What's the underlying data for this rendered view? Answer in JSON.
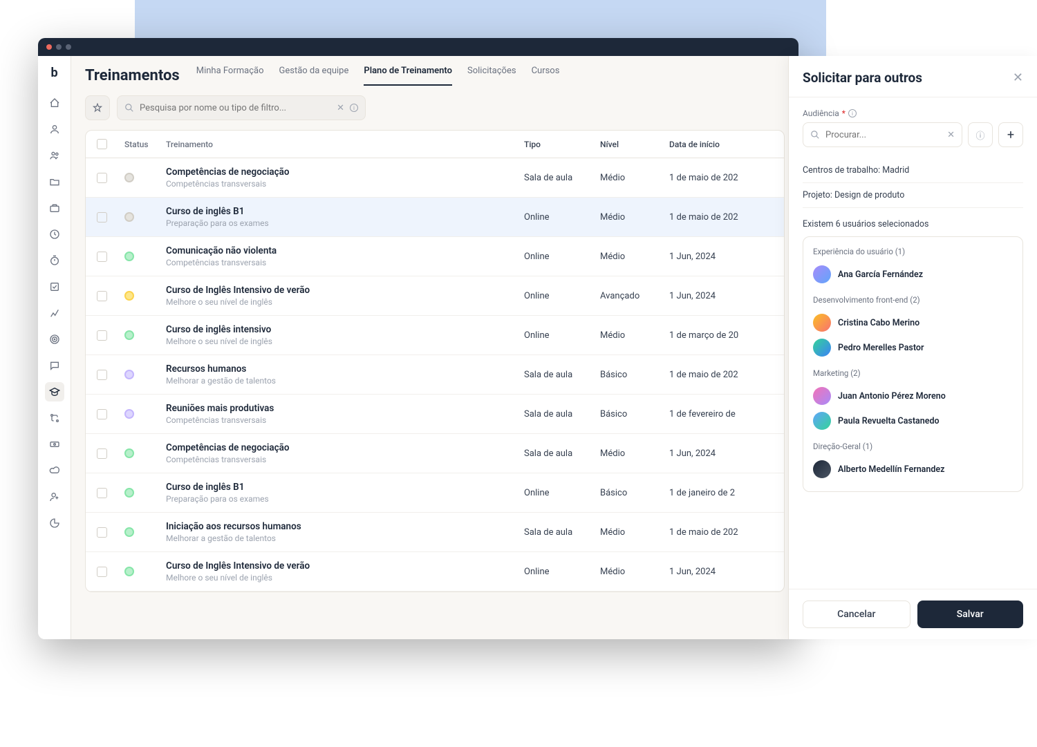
{
  "pageTitle": "Treinamentos",
  "tabs": [
    "Minha Formação",
    "Gestão da equipe",
    "Plano de Treinamento",
    "Solicitações",
    "Cursos"
  ],
  "activeTab": 2,
  "searchPlaceholder": "Pesquisa por nome ou tipo de filtro...",
  "columns": {
    "status": "Status",
    "name": "Treinamento",
    "type": "Tipo",
    "level": "Nível",
    "date": "Data de início"
  },
  "rows": [
    {
      "status": "grey",
      "title": "Competências de negociação",
      "sub": "Competências transversais",
      "type": "Sala de aula",
      "level": "Médio",
      "date": "1 de maio de 202"
    },
    {
      "status": "grey",
      "title": "Curso de inglês B1",
      "sub": "Preparação para os exames",
      "type": "Online",
      "level": "Médio",
      "date": "1 de maio de 202",
      "selected": true
    },
    {
      "status": "green",
      "title": "Comunicação não violenta",
      "sub": "Competências transversais",
      "type": "Online",
      "level": "Médio",
      "date": "1 Jun, 2024"
    },
    {
      "status": "yellow",
      "title": "Curso de Inglês Intensivo de verão",
      "sub": "Melhore o seu nível de inglês",
      "type": "Online",
      "level": "Avançado",
      "date": "1 Jun, 2024"
    },
    {
      "status": "green",
      "title": "Curso de inglês intensivo",
      "sub": "Melhore o seu nível de inglês",
      "type": "Online",
      "level": "Médio",
      "date": "1 de março de 20"
    },
    {
      "status": "purple",
      "title": "Recursos humanos",
      "sub": "Melhorar a gestão de talentos",
      "type": "Sala de aula",
      "level": "Básico",
      "date": "1 de maio de 202"
    },
    {
      "status": "purple",
      "title": "Reuniões mais produtivas",
      "sub": "Competências transversais",
      "type": "Sala de aula",
      "level": "Básico",
      "date": "1 de fevereiro de"
    },
    {
      "status": "green",
      "title": "Competências de negociação",
      "sub": "Competências transversais",
      "type": "Sala de aula",
      "level": "Médio",
      "date": "1 Jun, 2024"
    },
    {
      "status": "green",
      "title": "Curso de inglês B1",
      "sub": "Preparação para os exames",
      "type": "Online",
      "level": "Básico",
      "date": "1 de janeiro de 2"
    },
    {
      "status": "green",
      "title": "Iniciação aos recursos humanos",
      "sub": "Melhorar a gestão de talentos",
      "type": "Sala de aula",
      "level": "Médio",
      "date": "1 de maio de 202"
    },
    {
      "status": "green",
      "title": "Curso de Inglês Intensivo de verão",
      "sub": "Melhore o seu nível de inglês",
      "type": "Online",
      "level": "Médio",
      "date": "1 Jun, 2024"
    }
  ],
  "panel": {
    "title": "Solicitar para outros",
    "audienceLabel": "Audiência",
    "searchPlaceholder": "Procurar...",
    "filters": [
      "Centros de trabalho: Madrid",
      "Projeto: Design de produto"
    ],
    "selectedLabel": "Existem 6 usuários selecionados",
    "groups": [
      {
        "label": "Experiência do usuário (1)",
        "users": [
          {
            "name": "Ana García Fernández",
            "avatar": "a1"
          }
        ]
      },
      {
        "label": "Desenvolvimento front-end (2)",
        "users": [
          {
            "name": "Cristina Cabo Merino",
            "avatar": "a2"
          },
          {
            "name": "Pedro Merelles Pastor",
            "avatar": "a3"
          }
        ]
      },
      {
        "label": "Marketing (2)",
        "users": [
          {
            "name": "Juan Antonio Pérez Moreno",
            "avatar": "a4"
          },
          {
            "name": "Paula Revuelta Castanedo",
            "avatar": "a5"
          }
        ]
      },
      {
        "label": "Direção-Geral (1)",
        "users": [
          {
            "name": "Alberto Medellín Fernandez",
            "avatar": "a6"
          }
        ]
      }
    ],
    "cancel": "Cancelar",
    "save": "Salvar"
  }
}
